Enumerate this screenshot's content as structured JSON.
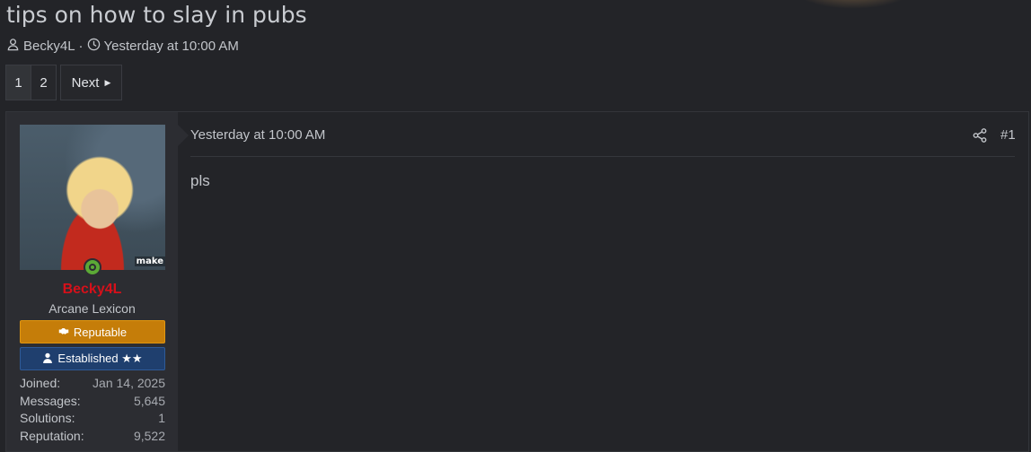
{
  "thread": {
    "title": "tips on how to slay in pubs",
    "author": "Becky4L",
    "separator": "·",
    "date": "Yesterday at 10:00 AM"
  },
  "pagination": {
    "pages": [
      "1",
      "2"
    ],
    "current": "1",
    "next_label": "Next"
  },
  "post": {
    "date": "Yesterday at 10:00 AM",
    "number": "#1",
    "body": "pls",
    "user": {
      "name": "Becky4L",
      "name_color": "#d6101a",
      "title": "Arcane Lexicon",
      "avatar_watermark": "make",
      "online": true,
      "banners": [
        {
          "label": "Reputable",
          "icon": "handshake-icon",
          "color": "#c57d09"
        },
        {
          "label": "Established ★★",
          "icon": "user-icon",
          "color": "#1f3f6e"
        }
      ],
      "stats": [
        {
          "label": "Joined:",
          "value": "Jan 14, 2025"
        },
        {
          "label": "Messages:",
          "value": "5,645"
        },
        {
          "label": "Solutions:",
          "value": "1"
        },
        {
          "label": "Reputation:",
          "value": "9,522"
        }
      ]
    }
  },
  "icons": {
    "author": "user-icon",
    "date": "clock-icon",
    "share": "share-icon",
    "next": "caret-right-icon"
  }
}
